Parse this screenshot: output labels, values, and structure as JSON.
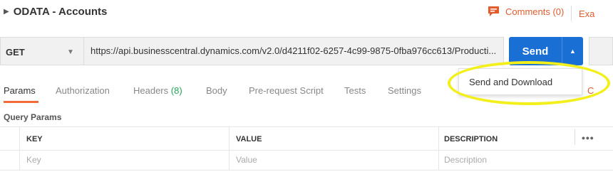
{
  "header": {
    "caret": "▶",
    "collection_name": "ODATA - Accounts",
    "comments_label": "Comments (0)",
    "examples_label": "Exa"
  },
  "request": {
    "method": "GET",
    "url": "https://api.businesscentral.dynamics.com/v2.0/d4211f02-6257-4c99-9875-0fba976cc613/Producti...",
    "send_label": "Send"
  },
  "send_menu": {
    "items": [
      "Send and Download"
    ]
  },
  "tabs": {
    "items": [
      {
        "label": "Params",
        "count": ""
      },
      {
        "label": "Authorization",
        "count": ""
      },
      {
        "label": "Headers",
        "count": "(8)"
      },
      {
        "label": "Body",
        "count": ""
      },
      {
        "label": "Pre-request Script",
        "count": ""
      },
      {
        "label": "Tests",
        "count": ""
      },
      {
        "label": "Settings",
        "count": ""
      }
    ],
    "active": "Params",
    "cookies_stub": "C"
  },
  "query_params": {
    "title": "Query Params",
    "columns": [
      "KEY",
      "VALUE",
      "DESCRIPTION"
    ],
    "placeholders": [
      "Key",
      "Value",
      "Description"
    ],
    "more_label": "•••"
  },
  "colors": {
    "accent_orange": "#f26b3a",
    "send_blue": "#1a6fd4",
    "count_green": "#26a65b",
    "highlight_yellow": "#f2ef1a"
  },
  "icons": {
    "comments": "comment-icon",
    "method_dropdown": "chevron-down-icon",
    "send_dropdown": "caret-up-icon"
  }
}
